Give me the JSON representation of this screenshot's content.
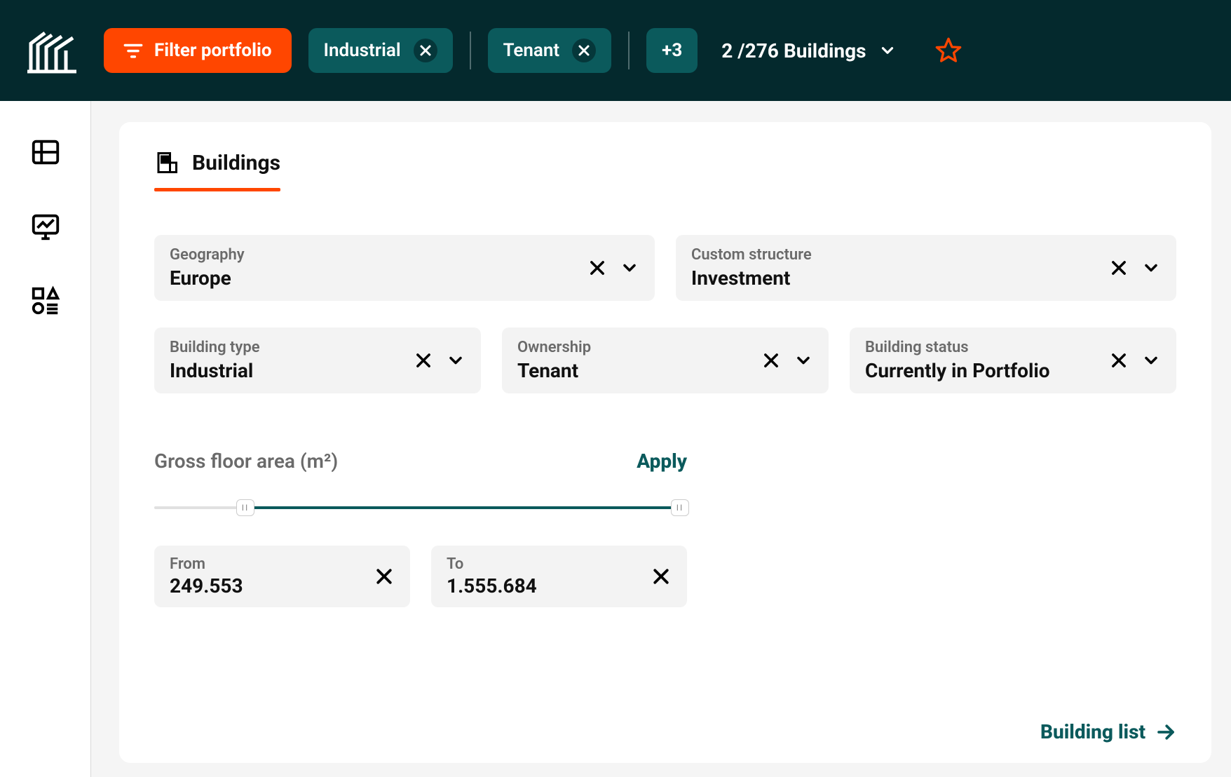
{
  "header": {
    "filter_button": "Filter portfolio",
    "chips": [
      {
        "label": "Industrial"
      },
      {
        "label": "Tenant"
      }
    ],
    "overflow_chip": "+3",
    "summary_prefix": "2 /",
    "summary_total": "276",
    "summary_suffix": "Buildings"
  },
  "tab": {
    "title": "Buildings"
  },
  "filters_row1": [
    {
      "label": "Geography",
      "value": "Europe"
    },
    {
      "label": "Custom structure",
      "value": "Investment"
    }
  ],
  "filters_row2": [
    {
      "label": "Building type",
      "value": "Industrial"
    },
    {
      "label": "Ownership",
      "value": "Tenant"
    },
    {
      "label": "Building status",
      "value": "Currently in Portfolio"
    }
  ],
  "slider": {
    "title": "Gross floor area (m²)",
    "apply": "Apply",
    "from_label": "From",
    "from_value": "249.553",
    "to_label": "To",
    "to_value": "1.555.684"
  },
  "footer": {
    "link": "Building list"
  }
}
